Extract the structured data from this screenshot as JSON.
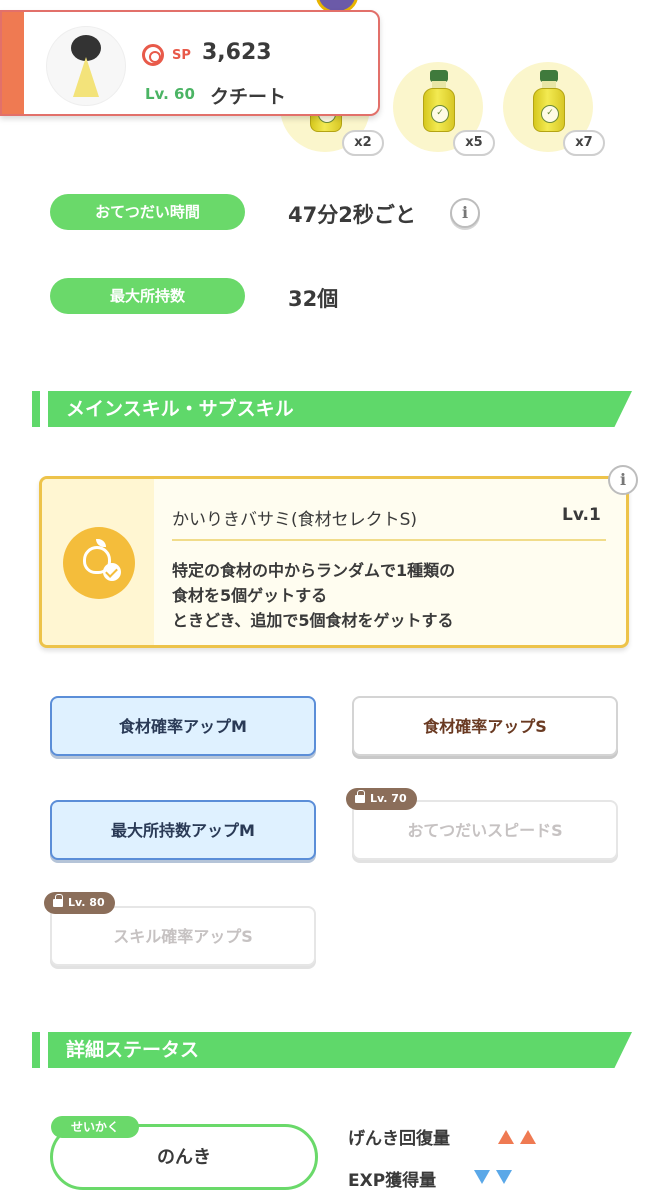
{
  "profile": {
    "sp_label": "SP",
    "sp_value": "3,623",
    "level_label": "Lv. 60",
    "name": "クチート"
  },
  "ingredients": [
    {
      "icon": "oil-bottle",
      "qty": "x2"
    },
    {
      "icon": "oil-bottle",
      "qty": "x5"
    },
    {
      "icon": "oil-bottle",
      "qty": "x7"
    }
  ],
  "stats": {
    "help_time_label": "おてつだい時間",
    "help_time_value": "47分2秒ごと",
    "max_carry_label": "最大所持数",
    "max_carry_value": "32個"
  },
  "sections": {
    "skills_title": "メインスキル・サブスキル",
    "details_title": "詳細ステータス"
  },
  "main_skill": {
    "name": "かいりきバサミ(食材セレクトS)",
    "level": "Lv.1",
    "desc_lines": [
      "特定の食材の中からランダムで1種類の",
      "食材を5個ゲットする",
      "ときどき、追加で5個食材をゲットする"
    ]
  },
  "sub_skills": [
    {
      "label": "食材確率アップM",
      "style": "blue"
    },
    {
      "label": "食材確率アップS",
      "style": "white"
    },
    {
      "label": "最大所持数アップM",
      "style": "blue"
    },
    {
      "label": "おてつだいスピードS",
      "style": "locked",
      "lock": "Lv. 70"
    },
    {
      "label": "スキル確率アップS",
      "style": "locked",
      "lock": "Lv. 80"
    }
  ],
  "nature": {
    "tag": "せいかく",
    "value": "のんき",
    "effects": [
      {
        "label": "げんき回復量",
        "direction": "up"
      },
      {
        "label": "EXP獲得量",
        "direction": "down"
      }
    ]
  },
  "colors": {
    "accent_green": "#5fd86a",
    "card_border": "#e2706a",
    "skill_gold": "#edc34a",
    "up_arrow": "#ef7a52",
    "down_arrow": "#5aa8e8"
  }
}
